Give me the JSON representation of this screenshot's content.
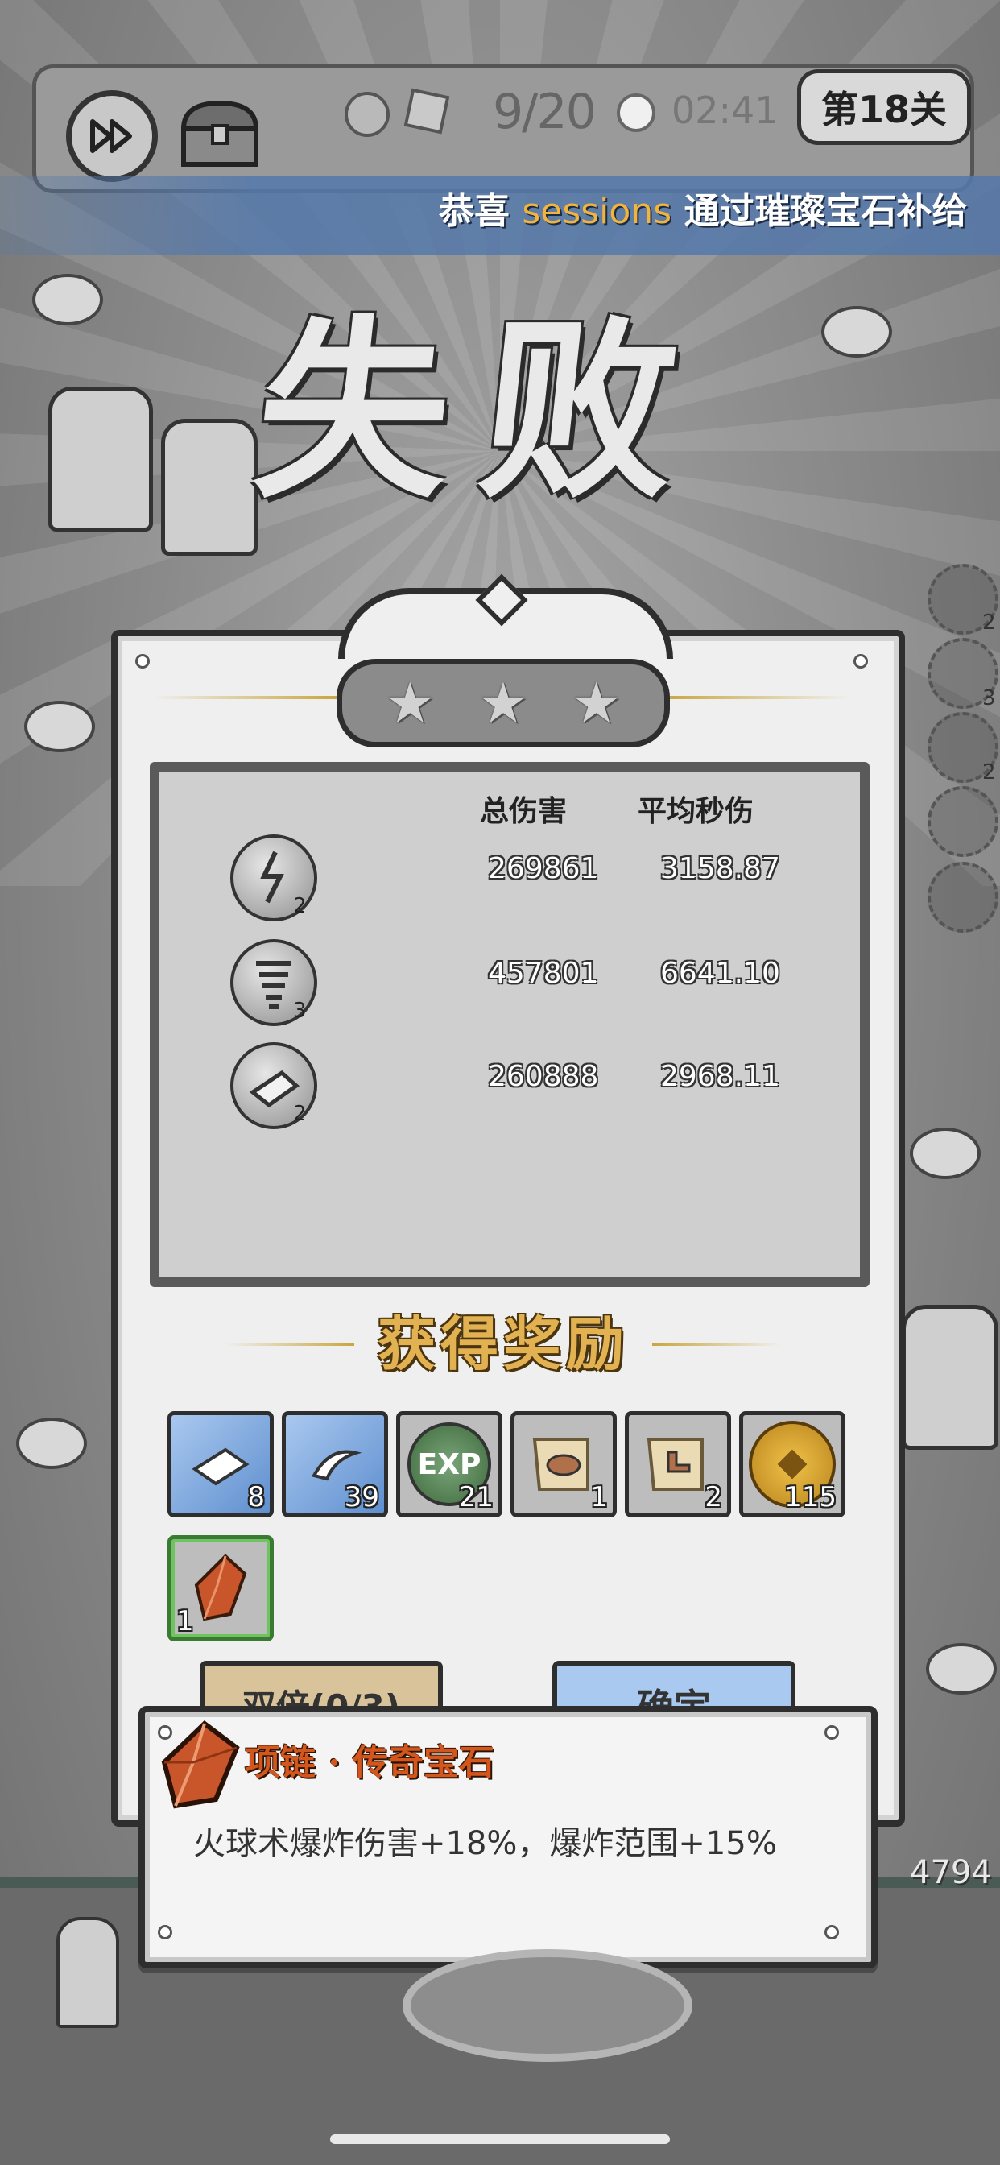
{
  "hud": {
    "wave_progress": "9/20",
    "timer": "02:41",
    "level_label": "第18关",
    "fast_forward_icon": "fast-forward-icon",
    "chest_icon": "treasure-chest-icon"
  },
  "banner": {
    "prefix": "恭喜",
    "player": "sessions",
    "suffix": "通过璀璨宝石补给"
  },
  "result_title": "失败",
  "stars": {
    "earned": 0,
    "total": 3
  },
  "stats": {
    "col_total": "总伤害",
    "col_avg": "平均秒伤",
    "rows": [
      {
        "icon": "lightning-skill-icon",
        "level": "2",
        "total": "269861",
        "avg": "3158.87"
      },
      {
        "icon": "tornado-skill-icon",
        "level": "3",
        "total": "457801",
        "avg": "6641.10"
      },
      {
        "icon": "ice-shard-skill-icon",
        "level": "2",
        "total": "260888",
        "avg": "2968.11"
      }
    ]
  },
  "rewards": {
    "title": "获得奖励",
    "items": [
      {
        "name": "ice-crystal-item",
        "count": "8",
        "color": "#6f9ed8"
      },
      {
        "name": "water-crystal-item",
        "count": "39",
        "color": "#6f9ed8"
      },
      {
        "name": "exp-orb-item",
        "count": "21",
        "color": "#5a8a5a",
        "label": "EXP"
      },
      {
        "name": "hat-scroll-item",
        "count": "1",
        "color": "#ddc9a0"
      },
      {
        "name": "boot-scroll-item",
        "count": "2",
        "color": "#ddc9a0"
      },
      {
        "name": "gold-coin-item",
        "count": "115",
        "color": "#d6a32c"
      },
      {
        "name": "legendary-gem-item",
        "count": "1",
        "color": "#c9552a"
      }
    ]
  },
  "buttons": {
    "double": "双倍(0/3)",
    "confirm": "确定"
  },
  "tooltip": {
    "title": "项链 · 传奇宝石",
    "description": "火球术爆炸伤害+18%，爆炸范围+15%"
  },
  "side_slots": [
    "2",
    "3",
    "2"
  ],
  "damage_number": "4794",
  "colors": {
    "accent_gold": "#e2b252",
    "banner_blue": "#5478aa",
    "legendary_orange": "#d4561c"
  }
}
